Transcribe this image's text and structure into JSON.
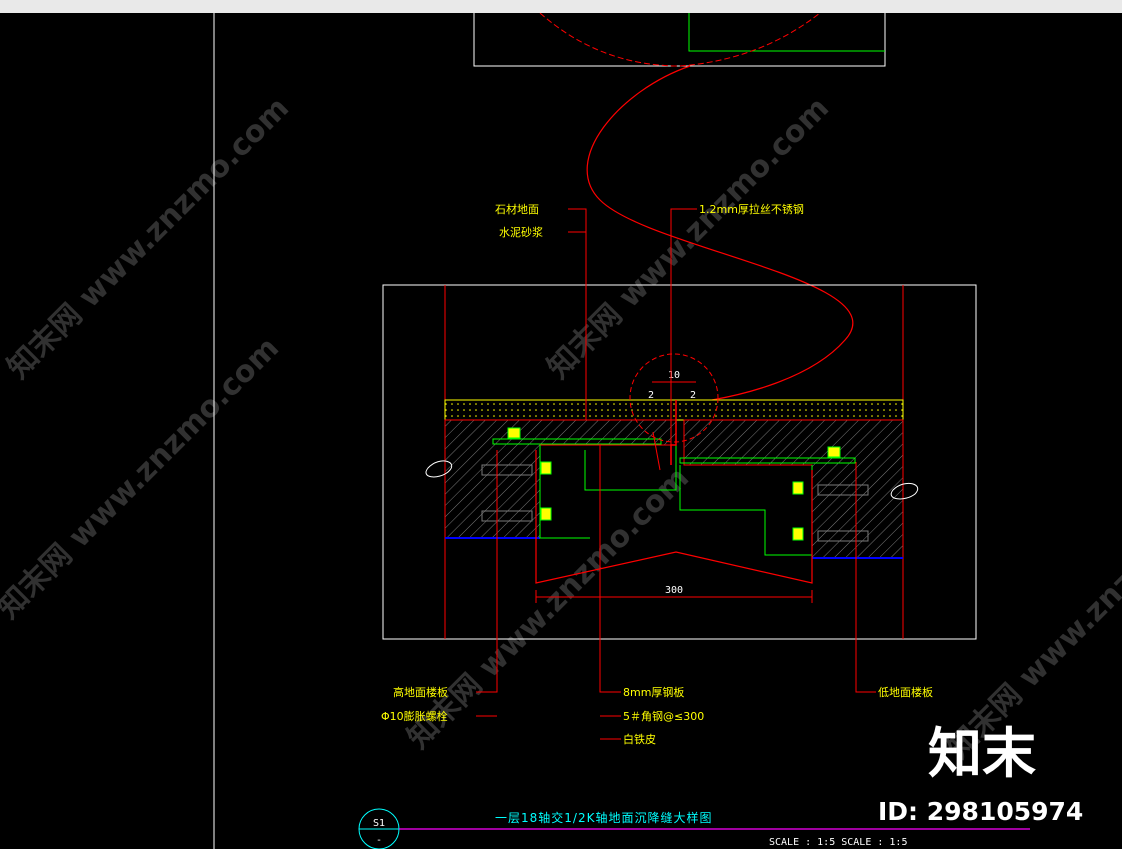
{
  "labels": {
    "stone_floor": "石材地面",
    "cement_mortar": "水泥砂浆",
    "stainless": "1.2mm厚拉丝不锈钢",
    "high_ground_slab": "高地面楼板",
    "anchor_bolt": "Φ10膨胀螺栓",
    "steel_plate": "8mm厚钢板",
    "angle_steel": "5＃角钢@≤300",
    "galvanized": "白铁皮",
    "low_ground_slab": "低地面楼板"
  },
  "dimensions": {
    "top_gap": "10",
    "width": "300",
    "small_left": "2",
    "small_right": "2"
  },
  "title": "一层18轴交1/2K轴地面沉降缝大样图",
  "symbol": {
    "top": "S1",
    "bottom": "-"
  },
  "scale_text": "SCALE :   1:5 SCALE :   1:5",
  "watermark": "知末网 www.znzmo.com",
  "logo": {
    "name": "知末",
    "id": "ID: 298105974"
  },
  "colors": {
    "red": "#ff0000",
    "green": "#00ff00",
    "yellow": "#ffff00",
    "cyan": "#00ffff",
    "magenta": "#ff00ff",
    "white": "#ffffff",
    "blue": "#0000ff"
  }
}
